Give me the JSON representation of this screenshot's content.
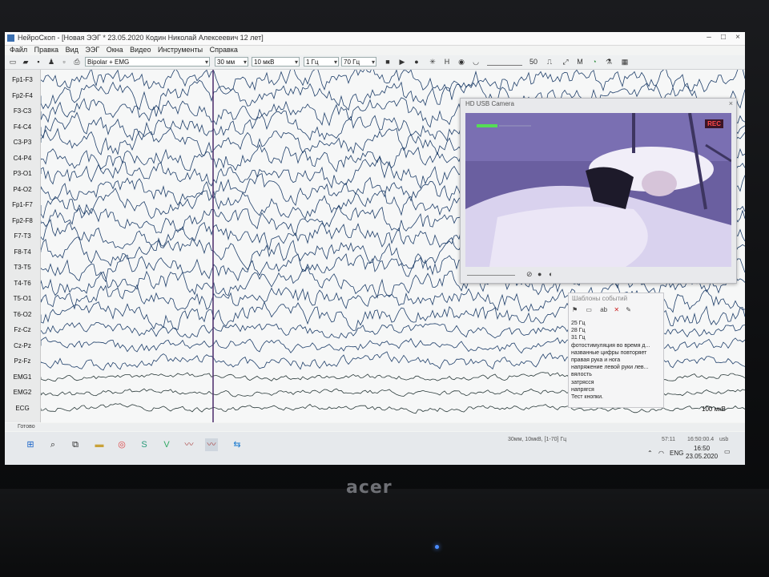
{
  "window": {
    "title": "НейроСкоп - [Новая ЭЭГ * 23.05.2020 Кодин Николай Алексеевич 12 лет]"
  },
  "menu": [
    "Файл",
    "Правка",
    "Вид",
    "ЭЭГ",
    "Окна",
    "Видео",
    "Инструменты",
    "Справка"
  ],
  "toolbar": {
    "montage": "Bipolar + EMG",
    "speed": "30 мм",
    "sensitivity": "10 мкВ",
    "low_filter": "1 Гц",
    "high_filter": "70 Гц",
    "value_50": "50"
  },
  "channels": [
    "Fp1-F3",
    "Fp2-F4",
    "F3-C3",
    "F4-C4",
    "C3-P3",
    "C4-P4",
    "P3-O1",
    "P4-O2",
    "Fp1-F7",
    "Fp2-F8",
    "F7-T3",
    "F8-T4",
    "T3-T5",
    "T4-T6",
    "T5-O1",
    "T6-O2",
    "Fz-Cz",
    "Cz-Pz",
    "Pz-Fz",
    "EMG1",
    "EMG2",
    "ECG"
  ],
  "camera": {
    "title": "HD USB Camera",
    "rec_label": "REC"
  },
  "events": {
    "title": "Шаблоны событий",
    "items": [
      "25 Гц",
      "28 Гц",
      "31 Гц",
      "фотостимуляция во время д...",
      "названные цифры повторяет",
      "правая рука и нога",
      "напряжение левой руки лев...",
      "вялость",
      "затрясся",
      "напрягся",
      "Тест кнопки."
    ]
  },
  "scale_label": "100 мкВ",
  "status": {
    "ready": "Готово",
    "params": "30мм, 10мкВ, [1-70] Гц",
    "time_a": "57:11",
    "time_b": "16:50:00.4",
    "device": "usb"
  },
  "taskbar": {
    "lang": "ENG",
    "clock_time": "16:50",
    "clock_date": "23.05.2020"
  },
  "brand": "acer"
}
